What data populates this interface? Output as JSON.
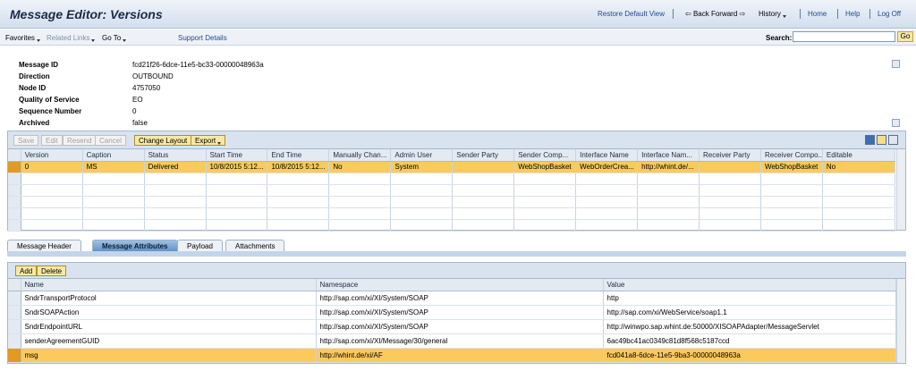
{
  "header": {
    "title": "Message Editor: Versions",
    "restore": "Restore Default View",
    "back_forward": "Back Forward",
    "history": "History",
    "home": "Home",
    "help": "Help",
    "logoff": "Log Off"
  },
  "menubar": {
    "favorites": "Favorites",
    "related_links": "Related Links",
    "goto": "Go To",
    "support": "Support Details",
    "search_label": "Search:",
    "search_value": "",
    "go": "Go"
  },
  "details": [
    {
      "label": "Message ID",
      "value": "fcd21f26-6dce-11e5-bc33-00000048963a"
    },
    {
      "label": "Direction",
      "value": "OUTBOUND"
    },
    {
      "label": "Node ID",
      "value": "4757050"
    },
    {
      "label": "Quality of Service",
      "value": "EO"
    },
    {
      "label": "Sequence Number",
      "value": "0"
    },
    {
      "label": "Archived",
      "value": "false"
    }
  ],
  "versions_toolbar": {
    "save": "Save",
    "edit": "Edit",
    "resend": "Resend",
    "cancel": "Cancel",
    "change_layout": "Change Layout",
    "export": "Export"
  },
  "versions": {
    "columns": [
      "Version",
      "Caption",
      "Status",
      "Start Time",
      "End Time",
      "Manually Chan...",
      "Admin User",
      "Sender Party",
      "Sender Comp...",
      "Interface Name",
      "Interface Nam...",
      "Receiver Party",
      "Receiver Compo...",
      "Editable"
    ],
    "rows": [
      [
        "0",
        "MS",
        "Delivered",
        "10/8/2015 5:12...",
        "10/8/2015 5:12...",
        "No",
        "System",
        "",
        "WebShopBasket",
        "WebOrderCrea...",
        "http://whint.de/...",
        "",
        "WebShopBasket",
        "No"
      ]
    ]
  },
  "tabs": [
    "Message Header",
    "Message Attributes",
    "Payload",
    "Attachments"
  ],
  "attr_toolbar": {
    "add": "Add",
    "delete": "Delete"
  },
  "attributes": {
    "columns": [
      "Name",
      "Namespace",
      "Value"
    ],
    "rows": [
      [
        "SndrTransportProtocol",
        "http://sap.com/xi/XI/System/SOAP",
        "http"
      ],
      [
        "SndrSOAPAction",
        "http://sap.com/xi/XI/System/SOAP",
        "http://sap.com/xi/WebService/soap1.1"
      ],
      [
        "SndrEndpointURL",
        "http://sap.com/xi/XI/System/SOAP",
        "http://winwpo.sap.whint.de:50000/XISOAPAdapter/MessageServlet"
      ],
      [
        "senderAgreementGUID",
        "http://sap.com/xi/XI/Message/30/general",
        "6ac49bc41ac0349c81d8f568c5187ccd"
      ],
      [
        "msg",
        "http://whint.de/xi/AF",
        "fcd041a8-6dce-11e5-9ba3-00000048963a"
      ]
    ]
  }
}
